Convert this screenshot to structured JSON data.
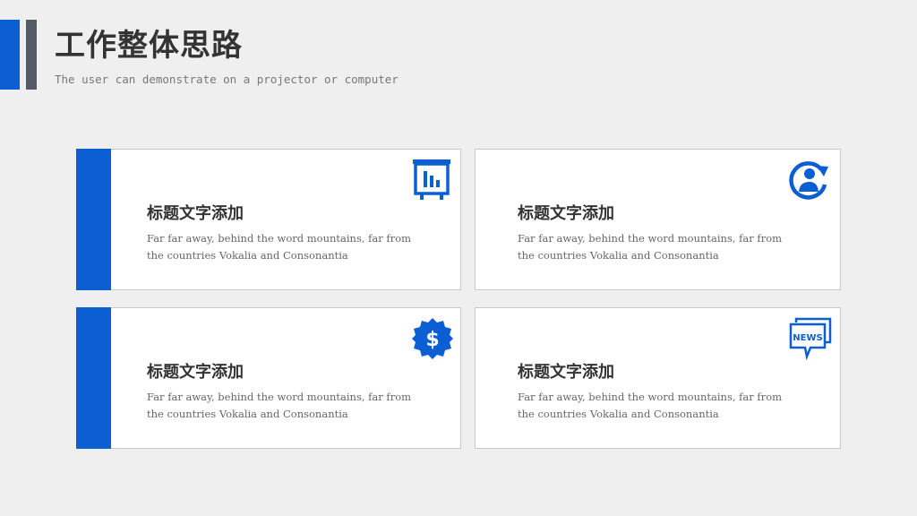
{
  "header": {
    "title": "工作整体思路",
    "subtitle": "The user can demonstrate on a projector or computer"
  },
  "colors": {
    "accent": "#0b5fd2",
    "secondary": "#555b66",
    "background": "#efefef"
  },
  "cards": [
    {
      "title": "标题文字添加",
      "desc": "Far far away, behind the word mountains, far from the countries Vokalia and Consonantia",
      "icon": "presentation-board-icon"
    },
    {
      "title": "标题文字添加",
      "desc": "Far far away, behind the word mountains, far from the countries Vokalia and Consonantia",
      "icon": "user-refresh-icon"
    },
    {
      "title": "标题文字添加",
      "desc": "Far far away, behind the word mountains, far from the countries Vokalia and Consonantia",
      "icon": "dollar-badge-icon"
    },
    {
      "title": "标题文字添加",
      "desc": "Far far away, behind the word mountains, far from the countries Vokalia and Consonantia",
      "icon": "news-chat-icon"
    }
  ],
  "icons": {
    "news_label": "NEWS"
  }
}
